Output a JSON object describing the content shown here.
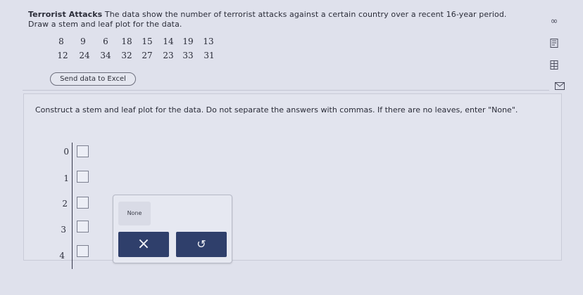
{
  "problem": {
    "title": "Terrorist Attacks",
    "text": "The data show the number of terrorist attacks against a certain country over a recent 16-year period.",
    "instruction": "Draw a stem and leaf plot for the data."
  },
  "data_rows": [
    [
      "8",
      "9",
      "6",
      "18",
      "15",
      "14",
      "19",
      "13"
    ],
    [
      "12",
      "24",
      "34",
      "32",
      "27",
      "23",
      "33",
      "31"
    ]
  ],
  "excel_button_label": "Send data to Excel",
  "question": {
    "instructions": "Construct a stem and leaf plot for the data. Do not separate the answers with commas. If there are no leaves, enter \"None\"."
  },
  "stems": [
    "0",
    "1",
    "2",
    "3",
    "4"
  ],
  "palette": {
    "none_label": "None",
    "clear_symbol": "×",
    "undo_symbol": "↺"
  },
  "side_icons": [
    "infinity-icon",
    "calculator-icon",
    "grid-icon",
    "mail-icon"
  ]
}
